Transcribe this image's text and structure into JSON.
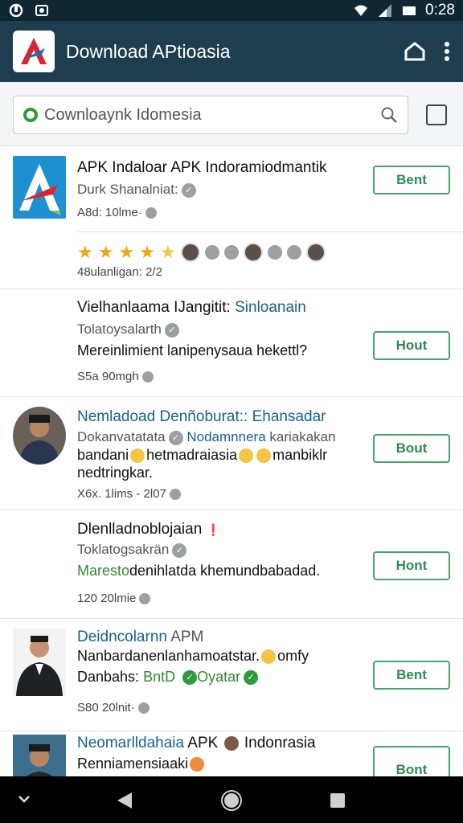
{
  "status": {
    "time": "0:28"
  },
  "appbar": {
    "title": "Download APtioasia"
  },
  "search": {
    "placeholder": "Cownloaynk Idomesia"
  },
  "items": [
    {
      "title": "APK Indaloar APK Indoramiodmantik",
      "sub": "Durk Shanalniat:",
      "meta": "A8d: 10lme·",
      "button": "Bent",
      "rating": "48ulanligan: 2/2"
    },
    {
      "title_a": "Vielhanlaama IJangitit: ",
      "title_b": "Sinloanain",
      "sub": "Tolatoysalarth",
      "body": "Mereinlimient lanipenysaua hekettl?",
      "meta": "S5a  90mgh",
      "button": "Hout"
    },
    {
      "title": "Nemladoad Denñoburat:: Ehansadar",
      "sub_a": "Dokanvatatata",
      "sub_b": "Nodamnnera",
      "sub_c": " kariakakan",
      "body_a": "bandani",
      "body_b": "hetmadraiasia",
      "body_c": "manbiklr",
      "body2": "nedtringkar.",
      "meta": "X6x. 1lims - 2l07",
      "button": "Bout"
    },
    {
      "title": "Dlenlladnoblojaian",
      "sub": "Toklatogsakrän",
      "body_a": "Maresto",
      "body_b": "denihlatda khemundbabadad.",
      "meta": "120  20lmie",
      "button": "Hont"
    },
    {
      "title_a": "Deidncolarnn",
      "title_b": " APM",
      "body": "Nanbardanenlanhamoatstar.",
      "body_b": "omfy",
      "body2_a": "Danbahs: ",
      "body2_b": "BntD",
      "body2_c": "Oyatar",
      "meta": "S80  20lnit·",
      "button": "Bent"
    },
    {
      "title_a": "Neomarlldahaia",
      "title_b": " APK ",
      "title_c": "Indonrasia",
      "body": "Renniamensiaaki",
      "button": "Bont"
    }
  ]
}
